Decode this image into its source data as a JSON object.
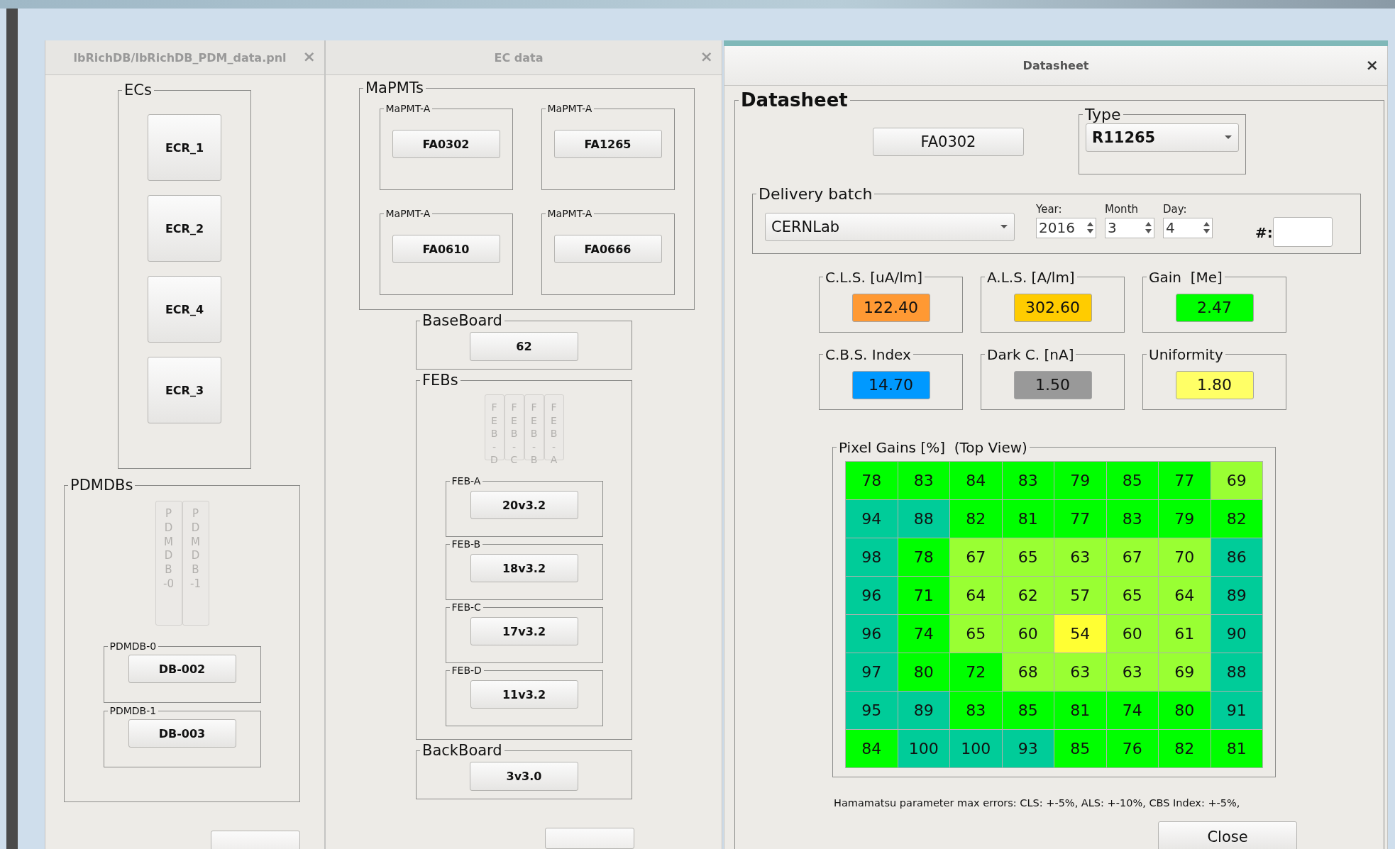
{
  "left_window": {
    "title": "lbRichDB/lbRichDB_PDM_data.pnl",
    "close": "×",
    "ecs": {
      "title": "ECs",
      "buttons": [
        "ECR_1",
        "ECR_2",
        "ECR_4",
        "ECR_3"
      ]
    },
    "pdmdbs": {
      "title": "PDMDBs",
      "vertical_tabs": [
        "PDMDB-0",
        "PDMDB-1"
      ],
      "groups": [
        {
          "title": "PDMDB-0",
          "value": "DB-002"
        },
        {
          "title": "PDMDB-1",
          "value": "DB-003"
        }
      ]
    }
  },
  "middle_window": {
    "title": "EC data",
    "close": "×",
    "mapmts": {
      "title": "MaPMTs",
      "items": [
        {
          "title": "MaPMT-A",
          "value": "FA0302"
        },
        {
          "title": "MaPMT-A",
          "value": "FA1265"
        },
        {
          "title": "MaPMT-A",
          "value": "FA0610"
        },
        {
          "title": "MaPMT-A",
          "value": "FA0666"
        }
      ]
    },
    "baseboard": {
      "title": "BaseBoard",
      "value": "62"
    },
    "febs": {
      "title": "FEBs",
      "vertical_tabs": [
        "FEB-D",
        "FEB-C",
        "FEB-B",
        "FEB-A"
      ],
      "items": [
        {
          "title": "FEB-A",
          "value": "20v3.2"
        },
        {
          "title": "FEB-B",
          "value": "18v3.2"
        },
        {
          "title": "FEB-C",
          "value": "17v3.2"
        },
        {
          "title": "FEB-D",
          "value": "11v3.2"
        }
      ]
    },
    "backboard": {
      "title": "BackBoard",
      "value": "3v3.0"
    }
  },
  "datasheet_window": {
    "title": "Datasheet",
    "close": "×",
    "group_title": "Datasheet",
    "serial": "FA0302",
    "type": {
      "title": "Type",
      "value": "R11265"
    },
    "delivery_batch": {
      "title": "Delivery batch",
      "source": "CERNLab",
      "year": {
        "label": "Year:",
        "value": "2016"
      },
      "month": {
        "label": "Month",
        "value": "3"
      },
      "day": {
        "label": "Day:",
        "value": "4"
      },
      "number_label": "#:"
    },
    "parameters": [
      {
        "title": "C.L.S. [uA/lm]",
        "value": "122.40",
        "color": "#ff9933"
      },
      {
        "title": "A.L.S. [A/lm]",
        "value": "302.60",
        "color": "#ffcc00"
      },
      {
        "title": "Gain  [Me]",
        "value": "2.47",
        "color": "#00ff00"
      },
      {
        "title": "C.B.S. Index",
        "value": "14.70",
        "color": "#0099ff"
      },
      {
        "title": "Dark C. [nA]",
        "value": "1.50",
        "color": "#999999"
      },
      {
        "title": "Uniformity",
        "value": "1.80",
        "color": "#ffff66"
      }
    ],
    "pixel_gains": {
      "title": "Pixel Gains [%]  (Top View)",
      "rows": [
        [
          {
            "value": "78",
            "color": "#00ff00"
          },
          {
            "value": "83",
            "color": "#00ff00"
          },
          {
            "value": "84",
            "color": "#00ff00"
          },
          {
            "value": "83",
            "color": "#00ff00"
          },
          {
            "value": "79",
            "color": "#00ff00"
          },
          {
            "value": "85",
            "color": "#00ff00"
          },
          {
            "value": "77",
            "color": "#00ff00"
          },
          {
            "value": "69",
            "color": "#99ff33"
          }
        ],
        [
          {
            "value": "94",
            "color": "#00cc99"
          },
          {
            "value": "88",
            "color": "#00cc99"
          },
          {
            "value": "82",
            "color": "#00ff00"
          },
          {
            "value": "81",
            "color": "#00ff00"
          },
          {
            "value": "77",
            "color": "#00ff00"
          },
          {
            "value": "83",
            "color": "#00ff00"
          },
          {
            "value": "79",
            "color": "#00ff00"
          },
          {
            "value": "82",
            "color": "#00ff00"
          }
        ],
        [
          {
            "value": "98",
            "color": "#00cc99"
          },
          {
            "value": "78",
            "color": "#00ff00"
          },
          {
            "value": "67",
            "color": "#99ff33"
          },
          {
            "value": "65",
            "color": "#99ff33"
          },
          {
            "value": "63",
            "color": "#99ff33"
          },
          {
            "value": "67",
            "color": "#99ff33"
          },
          {
            "value": "70",
            "color": "#99ff33"
          },
          {
            "value": "86",
            "color": "#00cc99"
          }
        ],
        [
          {
            "value": "96",
            "color": "#00cc99"
          },
          {
            "value": "71",
            "color": "#00ff00"
          },
          {
            "value": "64",
            "color": "#99ff33"
          },
          {
            "value": "62",
            "color": "#99ff33"
          },
          {
            "value": "57",
            "color": "#99ff33"
          },
          {
            "value": "65",
            "color": "#99ff33"
          },
          {
            "value": "64",
            "color": "#99ff33"
          },
          {
            "value": "89",
            "color": "#00cc99"
          }
        ],
        [
          {
            "value": "96",
            "color": "#00cc99"
          },
          {
            "value": "74",
            "color": "#00ff00"
          },
          {
            "value": "65",
            "color": "#99ff33"
          },
          {
            "value": "60",
            "color": "#99ff33"
          },
          {
            "value": "54",
            "color": "#ffff33"
          },
          {
            "value": "60",
            "color": "#99ff33"
          },
          {
            "value": "61",
            "color": "#99ff33"
          },
          {
            "value": "90",
            "color": "#00cc99"
          }
        ],
        [
          {
            "value": "97",
            "color": "#00cc99"
          },
          {
            "value": "80",
            "color": "#00ff00"
          },
          {
            "value": "72",
            "color": "#00ff00"
          },
          {
            "value": "68",
            "color": "#99ff33"
          },
          {
            "value": "63",
            "color": "#99ff33"
          },
          {
            "value": "63",
            "color": "#99ff33"
          },
          {
            "value": "69",
            "color": "#99ff33"
          },
          {
            "value": "88",
            "color": "#00cc99"
          }
        ],
        [
          {
            "value": "95",
            "color": "#00cc99"
          },
          {
            "value": "89",
            "color": "#00cc99"
          },
          {
            "value": "83",
            "color": "#00ff00"
          },
          {
            "value": "85",
            "color": "#00ff00"
          },
          {
            "value": "81",
            "color": "#00ff00"
          },
          {
            "value": "74",
            "color": "#00ff00"
          },
          {
            "value": "80",
            "color": "#00ff00"
          },
          {
            "value": "91",
            "color": "#00cc99"
          }
        ],
        [
          {
            "value": "84",
            "color": "#00ff00"
          },
          {
            "value": "100",
            "color": "#00cc99"
          },
          {
            "value": "100",
            "color": "#00cc99"
          },
          {
            "value": "93",
            "color": "#00cc99"
          },
          {
            "value": "85",
            "color": "#00ff00"
          },
          {
            "value": "76",
            "color": "#00ff00"
          },
          {
            "value": "82",
            "color": "#00ff00"
          },
          {
            "value": "81",
            "color": "#00ff00"
          }
        ]
      ]
    },
    "footnote": "Hamamatsu parameter max errors: CLS: +-5%, ALS: +-10%, CBS Index: +-5%,",
    "close_button": "Close"
  }
}
